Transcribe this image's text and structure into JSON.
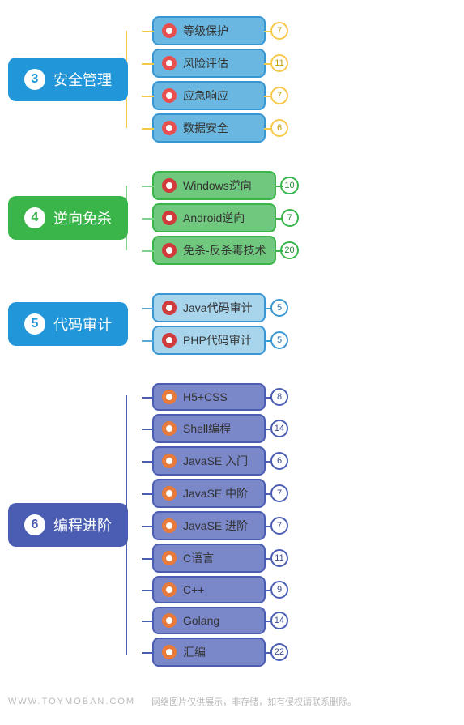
{
  "sections": [
    {
      "number": "3",
      "title": "安全管理",
      "rootBg": "#2196d9",
      "numColor": "#2196d9",
      "lineColor": "#f7c948",
      "childBg": "#6ab8e1",
      "childBorder": "#3897d3",
      "iconBg": "#e85050",
      "iconInner": "#fff",
      "badgeBorder": "#f7c948",
      "badgeColor": "#c49a00",
      "children": [
        {
          "label": "等级保护",
          "count": "7"
        },
        {
          "label": "风险评估",
          "count": "11"
        },
        {
          "label": "应急响应",
          "count": "7"
        },
        {
          "label": "数据安全",
          "count": "6"
        }
      ]
    },
    {
      "number": "4",
      "title": "逆向免杀",
      "rootBg": "#3ab54a",
      "numColor": "#3ab54a",
      "lineColor": "#7fd18f",
      "childBg": "#6fc87e",
      "childBorder": "#3ab54a",
      "iconBg": "#d13a3a",
      "iconInner": "#fff",
      "badgeBorder": "#3ab54a",
      "badgeColor": "#2a8a37",
      "children": [
        {
          "label": "Windows逆向",
          "count": "10"
        },
        {
          "label": "Android逆向",
          "count": "7"
        },
        {
          "label": "免杀-反杀毒技术",
          "count": "20"
        }
      ]
    },
    {
      "number": "5",
      "title": "代码审计",
      "rootBg": "#2196d9",
      "numColor": "#2196d9",
      "lineColor": "#5aa8d8",
      "childBg": "#a8d4ec",
      "childBorder": "#3897d3",
      "iconBg": "#d13a3a",
      "iconInner": "#fff",
      "badgeBorder": "#3897d3",
      "badgeColor": "#2a72a8",
      "children": [
        {
          "label": "Java代码审计",
          "count": "5"
        },
        {
          "label": "PHP代码审计",
          "count": "5"
        }
      ]
    },
    {
      "number": "6",
      "title": "编程进阶",
      "rootBg": "#4a5db3",
      "numColor": "#4a5db3",
      "lineColor": "#4a5db3",
      "childBg": "#7a87c9",
      "childBorder": "#4a5db3",
      "iconBg": "#e87a3a",
      "iconInner": "#fff",
      "badgeBorder": "#4a5db3",
      "badgeColor": "#3a4a8f",
      "children": [
        {
          "label": "H5+CSS",
          "count": "8"
        },
        {
          "label": "Shell编程",
          "count": "14"
        },
        {
          "label": "JavaSE 入门",
          "count": "6"
        },
        {
          "label": "JavaSE 中阶",
          "count": "7"
        },
        {
          "label": "JavaSE 进阶",
          "count": "7"
        },
        {
          "label": "C语言",
          "count": "11"
        },
        {
          "label": "C++",
          "count": "9"
        },
        {
          "label": "Golang",
          "count": "14"
        },
        {
          "label": "汇编",
          "count": "22"
        }
      ]
    }
  ],
  "footer": {
    "domain": "WWW.TOYMOBAN.COM",
    "notice": "网络图片仅供展示，非存储，如有侵权请联系删除。"
  }
}
